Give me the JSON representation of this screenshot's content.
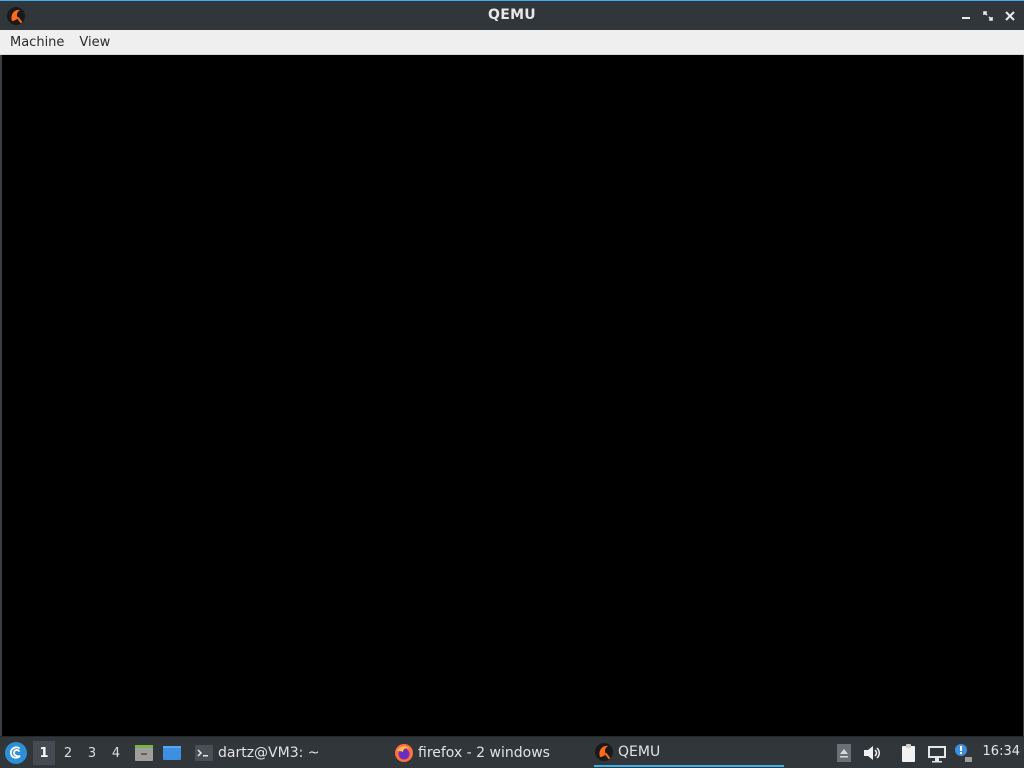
{
  "window": {
    "title": "QEMU",
    "app_icon": "qemu-icon",
    "controls": [
      "minimize-icon",
      "maximize-icon",
      "close-icon"
    ]
  },
  "menubar": {
    "items": [
      {
        "label": "Machine"
      },
      {
        "label": "View"
      }
    ]
  },
  "taskbar": {
    "start_icon": "debian-swirl-icon",
    "workspaces": [
      {
        "label": "1",
        "active": true
      },
      {
        "label": "2",
        "active": false
      },
      {
        "label": "3",
        "active": false
      },
      {
        "label": "4",
        "active": false
      }
    ],
    "quick_launch": [
      "file-manager-icon",
      "show-desktop-icon"
    ],
    "tasks": [
      {
        "label": "dartz@VM3: ~",
        "icon": "terminal-icon",
        "active": false
      },
      {
        "label": "firefox - 2 windows",
        "icon": "firefox-icon",
        "active": false
      },
      {
        "label": "QEMU",
        "icon": "qemu-icon",
        "active": true
      }
    ],
    "tray": [
      "tray-expand-icon",
      "volume-icon",
      "clipboard-icon",
      "network-icon",
      "update-notifier-icon"
    ],
    "clock": "16:34"
  },
  "colors": {
    "titlebar": "#31363b",
    "accent": "#3daee9",
    "menubar": "#efefef",
    "display": "#000000"
  }
}
